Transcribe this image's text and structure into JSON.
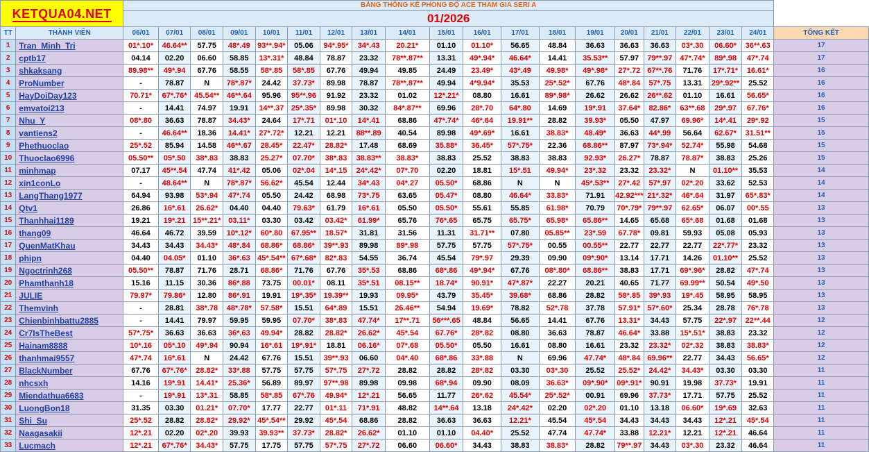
{
  "logo": "KETQUA04.NET",
  "title": "BẢNG THỐNG KÊ PHONG ĐỘ ACE THAM GIA SERI A",
  "month": "01/2026",
  "headers": {
    "tt": "TT",
    "member": "THÀNH VIÊN",
    "summary": "TỔNG KẾT"
  },
  "dates": [
    "06/01",
    "07/01",
    "08/01",
    "09/01",
    "10/01",
    "11/01",
    "12/01",
    "13/01",
    "14/01",
    "15/01",
    "16/01",
    "17/01",
    "18/01",
    "19/01",
    "20/01",
    "21/01",
    "22/01",
    "23/01",
    "24/01"
  ],
  "colors": {
    "red": "#e00000",
    "name_blue": "#1f3f9f",
    "header_blue": "#1f5fbf",
    "logo_bg": "#ffff00"
  },
  "rows": [
    {
      "tt": "1",
      "name": "Tran_Minh_Tri",
      "vals": [
        "01*.10*",
        "46.64**",
        "57.75",
        "48*.49",
        "93**.94*",
        "05.06",
        "94*.95*",
        "34*.43",
        "20.21*",
        "01.10",
        "01.10*",
        "56.65",
        "48.84",
        "36.63",
        "36.63",
        "36.63",
        "03*.30",
        "06.60*",
        "36**.63"
      ],
      "total": "17"
    },
    {
      "tt": "2",
      "name": "cptb17",
      "vals": [
        "04.14",
        "02.20",
        "06.60",
        "58.85",
        "13*.31*",
        "48.84",
        "78.87",
        "23.32",
        "78**.87**",
        "13.31",
        "49*.94*",
        "46.64*",
        "14.41",
        "35.53**",
        "57.97",
        "79**.97",
        "47*.74*",
        "89*.98",
        "47*.74"
      ],
      "total": "17"
    },
    {
      "tt": "3",
      "name": "shkaksang",
      "vals": [
        "89.98**",
        "49*.94",
        "67.76",
        "58.55",
        "58*.85",
        "58*.85",
        "67.76",
        "49.94",
        "49.85",
        "24.49",
        "23.49*",
        "43*.49",
        "49.98*",
        "49*.98*",
        "27*.72",
        "67**.76",
        "71.76",
        "17*.71*",
        "16.61*"
      ],
      "total": "16"
    },
    {
      "tt": "4",
      "name": "ProNumber",
      "vals": [
        "-",
        "78.87",
        "N",
        "78*.87*",
        "24.42",
        "37.73*",
        "89.98",
        "78.87",
        "78**.87**",
        "49.94",
        "4*9.94*",
        "35.53",
        "25*.52*",
        "67.76",
        "48*.84",
        "57*.75",
        "13.31",
        "29*.92**",
        "25.52"
      ],
      "total": "16"
    },
    {
      "tt": "5",
      "name": "HayDoiDay123",
      "vals": [
        "70.71*",
        "67*.76*",
        "45.54**",
        "46**.64",
        "95.96",
        "95**.96",
        "91.92",
        "23.32",
        "01.02",
        "12*.21*",
        "08.80",
        "16.61",
        "89*.98*",
        "26.62",
        "26.62",
        "26**.62",
        "01.10",
        "16.61",
        "56.65*"
      ],
      "total": "16"
    },
    {
      "tt": "6",
      "name": "emvatoi213",
      "vals": [
        "-",
        "14.41",
        "74.97",
        "19.91",
        "14**.37",
        "25*.35*",
        "89.98",
        "30.32",
        "84*.87**",
        "69.96",
        "28*.70",
        "64*.80",
        "14.69",
        "19*.91",
        "37.64*",
        "82.86*",
        "63**.68",
        "29*.97",
        "67.76*"
      ],
      "total": "16"
    },
    {
      "tt": "7",
      "name": "Nhu_Y",
      "vals": [
        "08*.80",
        "36.63",
        "78.87",
        "34.43*",
        "24.64",
        "17*.71",
        "01*.10",
        "14*.41",
        "68.86",
        "47*.74*",
        "46*.64",
        "19.91**",
        "28.82",
        "39.93*",
        "05.50",
        "47.97",
        "69.96*",
        "14*.41",
        "29*.92"
      ],
      "total": "15"
    },
    {
      "tt": "8",
      "name": "vantiens2",
      "vals": [
        "-",
        "46.64**",
        "18.36",
        "14.41*",
        "27*.72*",
        "12.21",
        "12.21",
        "88**.89",
        "40.54",
        "89.98",
        "49*.69*",
        "16.61",
        "38.83*",
        "48.49*",
        "36.63",
        "44*.99",
        "56.64",
        "62.67*",
        "31.51**"
      ],
      "total": "15"
    },
    {
      "tt": "9",
      "name": "Phethuoclao",
      "vals": [
        "25*.52",
        "85.94",
        "14.58",
        "46**.67",
        "28.45*",
        "22.47*",
        "28.82*",
        "17.48",
        "68.69",
        "35.88*",
        "36.45*",
        "57*.75*",
        "22.36",
        "68.86**",
        "87.97",
        "73*.94*",
        "52.74*",
        "55.98",
        "54.68"
      ],
      "total": "15"
    },
    {
      "tt": "10",
      "name": "Thuoclao6996",
      "vals": [
        "05.50**",
        "05*.50",
        "38*.83",
        "38.83",
        "25.27*",
        "07.70*",
        "38*.83",
        "38.83**",
        "38.83*",
        "38.83",
        "25.52",
        "38.83",
        "38.83",
        "92.93*",
        "26.27*",
        "78.87",
        "78.87*",
        "38.83",
        "25.26"
      ],
      "total": "15"
    },
    {
      "tt": "11",
      "name": "minhmap",
      "vals": [
        "07.17",
        "45**.54",
        "47.74",
        "41*.42",
        "05.06",
        "02*.04",
        "14*.15",
        "24*.42*",
        "07*.70",
        "02.20",
        "18.81",
        "15*.51",
        "49.94*",
        "23*.32",
        "23.32",
        "23.32*",
        "N",
        "01.10**",
        "35.53"
      ],
      "total": "14"
    },
    {
      "tt": "12",
      "name": "xin1conLo",
      "vals": [
        "-",
        "48.64**",
        "N",
        "78*.87*",
        "56.62*",
        "45.54",
        "12.44",
        "34*.43",
        "04*.27",
        "05.50*",
        "68.86",
        "N",
        "N",
        "45*.53**",
        "27*.42",
        "57*.97",
        "02*.20",
        "33.62",
        "52.53"
      ],
      "total": "14"
    },
    {
      "tt": "13",
      "name": "LangThang1977",
      "vals": [
        "64.94",
        "93.98",
        "53*.94",
        "47*.74",
        "05.50",
        "24.42",
        "68.98",
        "73*.75",
        "63.65",
        "05.47*",
        "08.80",
        "46.64*",
        "33.83*",
        "71.91",
        "42.92***",
        "21*.32*",
        "46*.64",
        "31.97",
        "65*.83*"
      ],
      "total": "14"
    },
    {
      "tt": "14",
      "name": "Qtv1",
      "vals": [
        "26.86",
        "16*.61",
        "26.62*",
        "04.40",
        "04.40",
        "79.63*",
        "61.79",
        "16*.61",
        "05.50",
        "05.50*",
        "55.61",
        "55.85",
        "61.98*",
        "70.79",
        "70*.79*",
        "79**.97",
        "62.65*",
        "06.07",
        "00*.55"
      ],
      "total": "13"
    },
    {
      "tt": "15",
      "name": "Thanhhai1189",
      "vals": [
        "19.21",
        "19*.21",
        "15**.21*",
        "03.11*",
        "03.30",
        "03.42",
        "03.42*",
        "61.99*",
        "65.76",
        "76*.65",
        "65.75",
        "65.75*",
        "65.98*",
        "65.86**",
        "14.65",
        "65.68",
        "65*.68",
        "01.68",
        "01.68"
      ],
      "total": "13"
    },
    {
      "tt": "16",
      "name": "thang09",
      "vals": [
        "46.64",
        "46.72",
        "39.59",
        "10*.12*",
        "60*.80",
        "67.95**",
        "18.57*",
        "31.81",
        "31.56",
        "11.31",
        "31.71**",
        "07.80",
        "05.85**",
        "23*.59",
        "67.78*",
        "09.81",
        "59.93",
        "05.08",
        "05.93"
      ],
      "total": "13"
    },
    {
      "tt": "17",
      "name": "QuenMatKhau",
      "vals": [
        "34.43",
        "34.43",
        "34.43*",
        "48*.84",
        "68.86*",
        "68.86*",
        "39**.93",
        "89.98",
        "89*.98",
        "57.75",
        "57.75",
        "57*.75*",
        "00.55",
        "00.55**",
        "22.77",
        "22.77",
        "22.77",
        "22*.77*",
        "23.32"
      ],
      "total": "13"
    },
    {
      "tt": "18",
      "name": "phipn",
      "vals": [
        "04.40",
        "04.05*",
        "01.10",
        "36*.63",
        "45*.54**",
        "67*.68*",
        "82*.83",
        "54.55",
        "36.74",
        "45.54",
        "79*.97",
        "29.39",
        "09.90",
        "09*.90*",
        "13.14",
        "17.71",
        "14.26",
        "01.10**",
        "25.52"
      ],
      "total": "13"
    },
    {
      "tt": "19",
      "name": "Ngoctrinh268",
      "vals": [
        "05.50**",
        "78.87",
        "71.76",
        "28.71",
        "68.86*",
        "71.76",
        "67.76",
        "35*.53",
        "68.86",
        "68*.86",
        "49*.94*",
        "67.76",
        "08*.80*",
        "68.86**",
        "38.83",
        "17.71",
        "69*.96*",
        "28.82",
        "47*.74"
      ],
      "total": "13"
    },
    {
      "tt": "20",
      "name": "Phamthanh18",
      "vals": [
        "15.16",
        "11.15",
        "30.36",
        "86*.88",
        "73.75",
        "00.01*",
        "08.11",
        "35*.51",
        "08.15**",
        "18.74*",
        "90.91*",
        "47*.87*",
        "22.27",
        "20.21",
        "40.65",
        "71.77",
        "69.99**",
        "50.54",
        "49*.50"
      ],
      "total": "13"
    },
    {
      "tt": "21",
      "name": "JULIE",
      "vals": [
        "79.97*",
        "79.86*",
        "12.80",
        "86*.91",
        "19.91",
        "19*.35*",
        "19.39**",
        "19.93",
        "09.95*",
        "43.79",
        "35.45*",
        "39.68*",
        "68.86",
        "28.82",
        "58*.85",
        "39*.93",
        "19*.45",
        "58.95",
        "58.95"
      ],
      "total": "13"
    },
    {
      "tt": "22",
      "name": "Themvinh",
      "vals": [
        "-",
        "28.81",
        "38*.78",
        "48*.78*",
        "57.58*",
        "15.51",
        "64*.89",
        "15.51",
        "26.46**",
        "54.94",
        "19.69*",
        "78.82",
        "52*.78",
        "37.78",
        "57.91*",
        "57*.60*",
        "25.34",
        "28.78",
        "76*.78"
      ],
      "total": "13"
    },
    {
      "tt": "23",
      "name": "Chienbinhbattu2885",
      "vals": [
        "-",
        "14.41",
        "79.97",
        "59.95",
        "59.95",
        "07.70*",
        "38*.83",
        "47.74*",
        "17**.71",
        "56***.65",
        "48.84",
        "56.65",
        "14.41",
        "67.76",
        "13.31*",
        "34.43",
        "57.75",
        "22*.97",
        "22**.44"
      ],
      "total": "12"
    },
    {
      "tt": "24",
      "name": "Cr7IsTheBest",
      "vals": [
        "57*.75*",
        "36.63",
        "36.63",
        "36*.63",
        "49.94*",
        "28.82",
        "28.82*",
        "26.62*",
        "45*.54",
        "67.76*",
        "28*.82",
        "08.80",
        "36.63",
        "78.87",
        "46.64*",
        "33.88",
        "15*.51*",
        "38.83",
        "23.32"
      ],
      "total": "12"
    },
    {
      "tt": "25",
      "name": "Hainam8888",
      "vals": [
        "10*.16",
        "05*.10",
        "49*.94",
        "90.94",
        "16*.61",
        "19*.91*",
        "18.81",
        "06.16*",
        "07*.68",
        "05.50*",
        "05.50",
        "16.61",
        "08.80",
        "16.61",
        "23.32",
        "23.32*",
        "02*.32",
        "38.83",
        "38.83*"
      ],
      "total": "12"
    },
    {
      "tt": "26",
      "name": "thanhmai9557",
      "vals": [
        "47*.74",
        "16*.61",
        "N",
        "24.42",
        "67.76",
        "15.51",
        "39**.93",
        "06.60",
        "04*.40",
        "68*.86",
        "33*.88",
        "N",
        "69.96",
        "47.74*",
        "48*.84",
        "69.96**",
        "22.77",
        "34.43",
        "56.65*"
      ],
      "total": "12"
    },
    {
      "tt": "27",
      "name": "BlackNumber",
      "vals": [
        "67.76",
        "67*.76*",
        "28.82*",
        "33*.88",
        "57.75",
        "57.75",
        "57*.75",
        "27*.72",
        "28.82",
        "28.82",
        "28*.82",
        "03.30",
        "03*.30",
        "25.52",
        "25.52*",
        "24.42*",
        "34.43*",
        "03.30",
        "03.30"
      ],
      "total": "11"
    },
    {
      "tt": "28",
      "name": "nhcsxh",
      "vals": [
        "14.16",
        "19*.91",
        "14.41*",
        "25.36*",
        "56.89",
        "89.97",
        "97**.98",
        "89.98",
        "09.98",
        "68*.94",
        "09.90",
        "08.09",
        "36.63*",
        "09*.90*",
        "09*.91*",
        "90.91",
        "19.98",
        "37.73*",
        "19.91"
      ],
      "total": "11"
    },
    {
      "tt": "29",
      "name": "Miendathua6683",
      "vals": [
        "-",
        "19*.91",
        "13*.31",
        "58.85",
        "58*.85",
        "67*.76",
        "49.94*",
        "12*.21",
        "56.65",
        "11.77",
        "26*.62",
        "45.54*",
        "25*.52*",
        "00.91",
        "69.96",
        "37.73*",
        "17.71",
        "57.75",
        "25.52"
      ],
      "total": "11"
    },
    {
      "tt": "30",
      "name": "LuongBon18",
      "vals": [
        "31.35",
        "03.30",
        "01.21*",
        "07.70*",
        "17.77",
        "22.77",
        "01*.11",
        "71*.91",
        "48.82",
        "14**.64",
        "13.18",
        "24*.42*",
        "02.20",
        "02*.20",
        "01.10",
        "13.18",
        "06.60*",
        "19*.69",
        "32.63"
      ],
      "total": "11"
    },
    {
      "tt": "31",
      "name": "Shi_Su",
      "vals": [
        "25*.52",
        "28.82",
        "28.82*",
        "29.92*",
        "45*.54**",
        "29.92",
        "45*.54",
        "68.86",
        "28.82",
        "36.63",
        "36.63",
        "12.21*",
        "45.54",
        "45*.54",
        "34.43",
        "34.43",
        "34.43",
        "12*.21",
        "45*.54"
      ],
      "total": "11"
    },
    {
      "tt": "32",
      "name": "Naagasakii",
      "vals": [
        "12*.21",
        "02.20",
        "02*.20",
        "39.93",
        "39.93**",
        "37.73*",
        "28.82*",
        "26.62*",
        "01.10",
        "01.10",
        "04.40*",
        "25.52",
        "47.74",
        "47.74*",
        "33.88",
        "12.21*",
        "12.21",
        "12*.21",
        "46.64"
      ],
      "total": "11"
    },
    {
      "tt": "33",
      "name": "Lucmach",
      "vals": [
        "12*.21",
        "67*.76*",
        "34.43*",
        "57.75",
        "17.75",
        "57.75",
        "57*.75",
        "27*.72",
        "06.60",
        "06.60*",
        "34.43",
        "38.83",
        "38.83*",
        "28.82",
        "79**.97",
        "34.43",
        "03*.30",
        "23.32",
        "46.64"
      ],
      "total": "11"
    }
  ]
}
